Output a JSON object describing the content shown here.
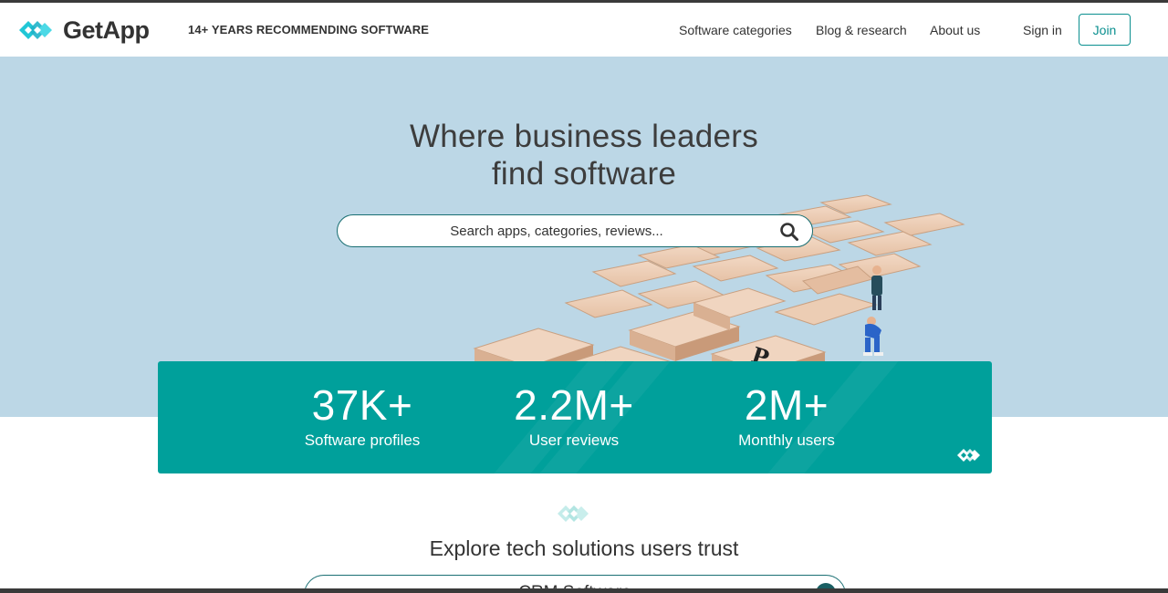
{
  "header": {
    "logo_text": "GetApp",
    "tagline": "14+ YEARS RECOMMENDING SOFTWARE",
    "nav": {
      "categories": "Software categories",
      "blog": "Blog & research",
      "about": "About us",
      "signin": "Sign in",
      "join": "Join"
    }
  },
  "hero": {
    "title_line1": "Where business leaders",
    "title_line2": "find software",
    "search_placeholder": "Search apps, categories, reviews..."
  },
  "stats": [
    {
      "value": "37K+",
      "label": "Software profiles"
    },
    {
      "value": "2.2M+",
      "label": "User reviews"
    },
    {
      "value": "2M+",
      "label": "Monthly users"
    }
  ],
  "explore": {
    "title": "Explore tech solutions users trust",
    "field_value": "CRM Software"
  },
  "colors": {
    "brand_teal": "#00a09b",
    "hero_bg": "#bcd7e6",
    "accent_dark": "#1a6f73",
    "logo_cyan": "#21c7d6"
  },
  "icons": {
    "logo": "getapp-chevrons-icon",
    "search": "search-icon"
  }
}
